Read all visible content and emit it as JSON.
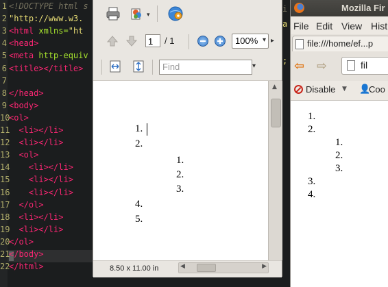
{
  "editor": {
    "line_numbers": [
      "1",
      "2",
      "3",
      "4",
      "5",
      "6",
      "7",
      "8",
      "9",
      "10",
      "11",
      "12",
      "13",
      "14",
      "15",
      "16",
      "17",
      "18",
      "19",
      "20",
      "21",
      "22"
    ],
    "lines": [
      {
        "parts": [
          [
            "cmt",
            "<!DOCTYPE html s"
          ]
        ]
      },
      {
        "parts": [
          [
            "str",
            "\"http://www.w3."
          ]
        ]
      },
      {
        "parts": [
          [
            "tag",
            "<html "
          ],
          [
            "attr",
            "xmlns="
          ],
          [
            "str",
            "\"ht"
          ]
        ]
      },
      {
        "parts": [
          [
            "tag",
            "<head>"
          ]
        ]
      },
      {
        "parts": [
          [
            "tag",
            "<meta "
          ],
          [
            "attr",
            "http-equiv"
          ]
        ]
      },
      {
        "parts": [
          [
            "tag",
            "<title></title>"
          ]
        ]
      },
      {
        "parts": []
      },
      {
        "parts": [
          [
            "tag",
            "</head>"
          ]
        ]
      },
      {
        "parts": [
          [
            "tag",
            "<body>"
          ]
        ]
      },
      {
        "parts": [
          [
            "tag",
            "<ol>"
          ]
        ]
      },
      {
        "parts": [
          [
            "txt",
            "  "
          ],
          [
            "tag",
            "<li></li>"
          ]
        ]
      },
      {
        "parts": [
          [
            "txt",
            "  "
          ],
          [
            "tag",
            "<li></li>"
          ]
        ]
      },
      {
        "parts": [
          [
            "txt",
            "  "
          ],
          [
            "tag",
            "<ol>"
          ]
        ]
      },
      {
        "parts": [
          [
            "txt",
            "    "
          ],
          [
            "tag",
            "<li></li>"
          ]
        ]
      },
      {
        "parts": [
          [
            "txt",
            "    "
          ],
          [
            "tag",
            "<li></li>"
          ]
        ]
      },
      {
        "parts": [
          [
            "txt",
            "    "
          ],
          [
            "tag",
            "<li></li>"
          ]
        ]
      },
      {
        "parts": [
          [
            "txt",
            "  "
          ],
          [
            "tag",
            "</ol>"
          ]
        ]
      },
      {
        "parts": [
          [
            "txt",
            "  "
          ],
          [
            "tag",
            "<li></li>"
          ]
        ]
      },
      {
        "parts": [
          [
            "txt",
            "  "
          ],
          [
            "tag",
            "<li></li>"
          ]
        ]
      },
      {
        "parts": [
          [
            "tag",
            "</ol>"
          ]
        ]
      },
      {
        "parts": [
          [
            "tag",
            "</body>"
          ]
        ]
      },
      {
        "parts": [
          [
            "tag",
            "</html>"
          ]
        ]
      }
    ]
  },
  "viewer": {
    "page_input": "1",
    "page_total": "/ 1",
    "zoom": "100%",
    "find_placeholder": "Find",
    "page_size": "8.50 x 11.00 in",
    "outer_list": [
      "1.",
      "2.",
      "4.",
      "5."
    ],
    "inner_list": [
      "1.",
      "2.",
      "3."
    ]
  },
  "browser": {
    "title": "Mozilla Fir",
    "menu": [
      "File",
      "Edit",
      "View",
      "Hist"
    ],
    "tab_url": "file:///home/ef...p",
    "address": "fil",
    "dev_disable": "Disable",
    "dev_cookies": "Coo",
    "outer_list": [
      "1.",
      "2.",
      "3.",
      "4."
    ],
    "inner_list": [
      "1.",
      "2.",
      "3."
    ]
  },
  "colors": {
    "editor_bg": "#1b1d1e",
    "tag": "#f92672",
    "attr": "#a6e22e",
    "string": "#e6db74",
    "comment": "#75715e",
    "window_bg": "#e9e6e1"
  }
}
